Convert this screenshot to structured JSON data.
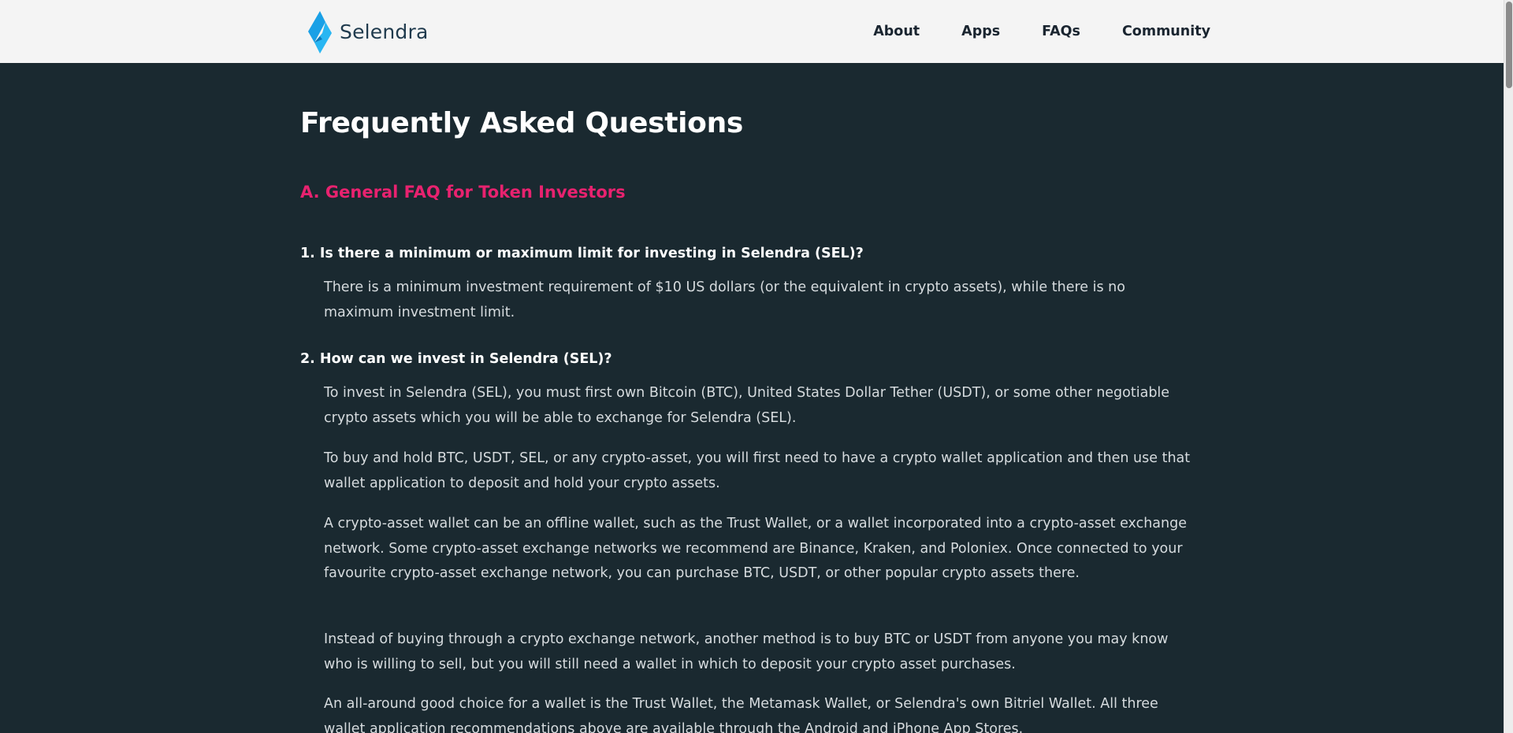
{
  "header": {
    "logo_text": "Selendra",
    "nav": [
      "About",
      "Apps",
      "FAQs",
      "Community"
    ]
  },
  "colors": {
    "background": "#1a2930",
    "header_bg": "#f4f4f4",
    "section_accent": "#e8226f",
    "logo_blue": "#1aa0e6"
  },
  "main": {
    "title": "Frequently Asked Questions",
    "section_title": "A. General FAQ for Token Investors",
    "questions": [
      {
        "question": "1. Is there a minimum or maximum limit for investing in Selendra (SEL)?",
        "answers": [
          "There is a minimum investment requirement of $10 US dollars (or the equivalent in crypto assets), while there is no maximum investment limit."
        ]
      },
      {
        "question": "2. How can we invest in Selendra (SEL)?",
        "answers": [
          "To invest in Selendra (SEL), you must first own Bitcoin (BTC), United States Dollar Tether (USDT), or some other negotiable crypto assets which you will be able to exchange for Selendra (SEL).",
          "To buy and hold BTC, USDT, SEL, or any crypto-asset, you will first need to have a crypto wallet application and then use that wallet application to deposit and hold your crypto assets.",
          "A crypto-asset wallet can be an offline wallet, such as the Trust Wallet, or a wallet incorporated into a crypto-asset exchange network. Some crypto-asset exchange networks we recommend are Binance, Kraken, and Poloniex. Once connected to your favourite crypto-asset exchange network, you can purchase BTC, USDT, or other popular crypto assets there.",
          "Instead of buying through a crypto exchange network, another method is to buy BTC or USDT from anyone you may know who is willing to sell, but you will still need a wallet in which to deposit your crypto asset purchases.",
          "An all-around good choice for a wallet is the Trust Wallet, the Metamask Wallet, or Selendra's own Bitriel Wallet. All three wallet application recommendations above are available through the Android and iPhone App Stores."
        ]
      }
    ]
  }
}
